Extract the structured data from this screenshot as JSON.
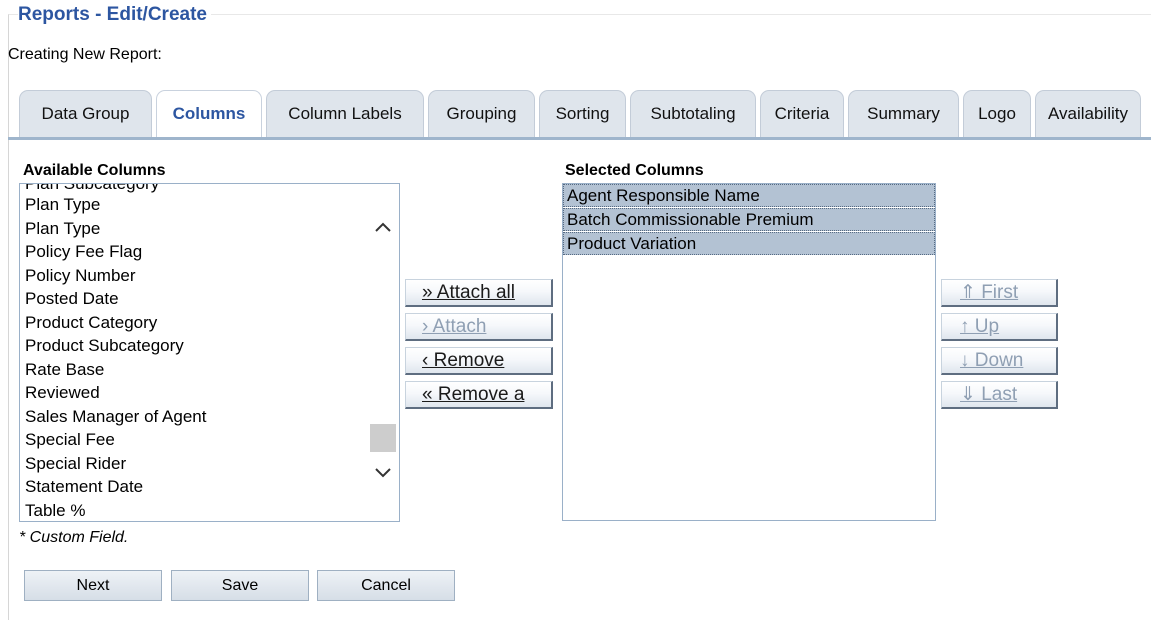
{
  "page": {
    "title": "Reports - Edit/Create",
    "subtitle": "Creating New Report:"
  },
  "tabs": [
    {
      "label": "Data Group",
      "active": false
    },
    {
      "label": "Columns",
      "active": true
    },
    {
      "label": "Column Labels",
      "active": false
    },
    {
      "label": "Grouping",
      "active": false
    },
    {
      "label": "Sorting",
      "active": false
    },
    {
      "label": "Subtotaling",
      "active": false
    },
    {
      "label": "Criteria",
      "active": false
    },
    {
      "label": "Summary",
      "active": false
    },
    {
      "label": "Logo",
      "active": false
    },
    {
      "label": "Availability",
      "active": false
    }
  ],
  "available": {
    "label": "Available Columns",
    "items": [
      "Plan Subcategory",
      "Plan Type",
      "Plan Type",
      "Policy Fee Flag",
      "Policy Number",
      "Posted Date",
      "Product Category",
      "Product Subcategory",
      "Rate Base",
      "Reviewed",
      "Sales Manager of Agent",
      "Special Fee",
      "Special Rider",
      "Statement Date",
      "Table %"
    ],
    "scroll_up_icon": "chevron-up-icon",
    "scroll_down_icon": "chevron-down-icon"
  },
  "selected": {
    "label": "Selected Columns",
    "items": [
      "Agent Responsible Name",
      "Batch Commissionable Premium",
      "Product Variation"
    ]
  },
  "transfer_buttons": {
    "attach_all": "» Attach all",
    "attach": "› Attach",
    "remove": "‹ Remove",
    "remove_all": "« Remove a"
  },
  "order_buttons": {
    "first": "⇑ First",
    "up": "↑ Up",
    "down": "↓ Down",
    "last": "⇓ Last"
  },
  "footnote": "* Custom Field.",
  "actions": {
    "next": "Next",
    "save": "Save",
    "cancel": "Cancel"
  },
  "colors": {
    "title": "#2d56a1",
    "tab_bg": "#dfe5ec",
    "tab_rule": "#9fb5cc",
    "selected_item_bg": "#b3c2d3",
    "disabled_text": "#8f9fb3"
  }
}
